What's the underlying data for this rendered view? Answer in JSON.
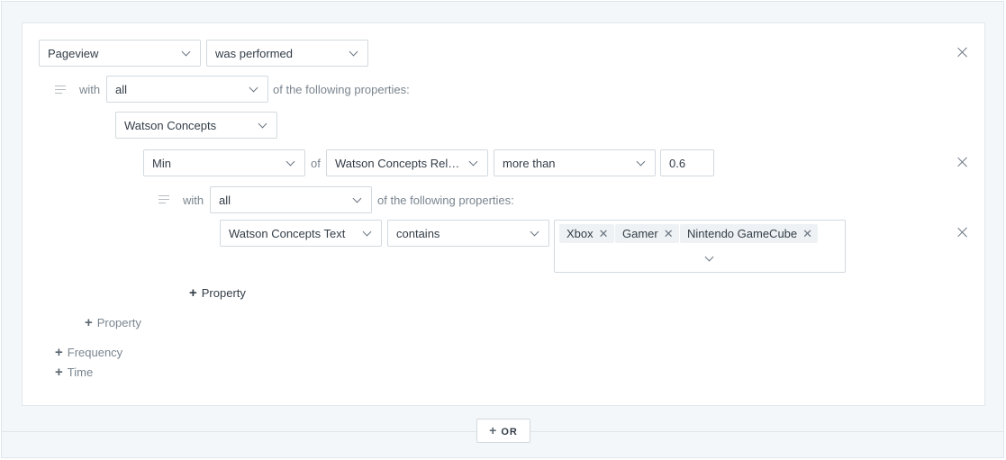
{
  "row1": {
    "event": "Pageview",
    "action": "was performed"
  },
  "row2": {
    "with": "with",
    "quantifier": "all",
    "suffix": "of the following properties:"
  },
  "row3": {
    "property": "Watson Concepts"
  },
  "row4": {
    "aggregate": "Min",
    "of": "of",
    "field": "Watson Concepts Relev...",
    "operator": "more than",
    "value": "0.6"
  },
  "row5": {
    "with": "with",
    "quantifier": "all",
    "suffix": "of the following properties:"
  },
  "row6": {
    "property": "Watson Concepts Text",
    "operator": "contains",
    "tags": [
      "Xbox",
      "Gamer",
      "Nintendo GameCube"
    ]
  },
  "links": {
    "property_inner": "Property",
    "property_outer": "Property",
    "frequency": "Frequency",
    "time": "Time"
  },
  "or_button": "OR",
  "icons": {
    "remove": "close-icon",
    "dropdown": "chevron-down-icon",
    "drag": "drag-handle-icon",
    "add": "plus-icon"
  }
}
